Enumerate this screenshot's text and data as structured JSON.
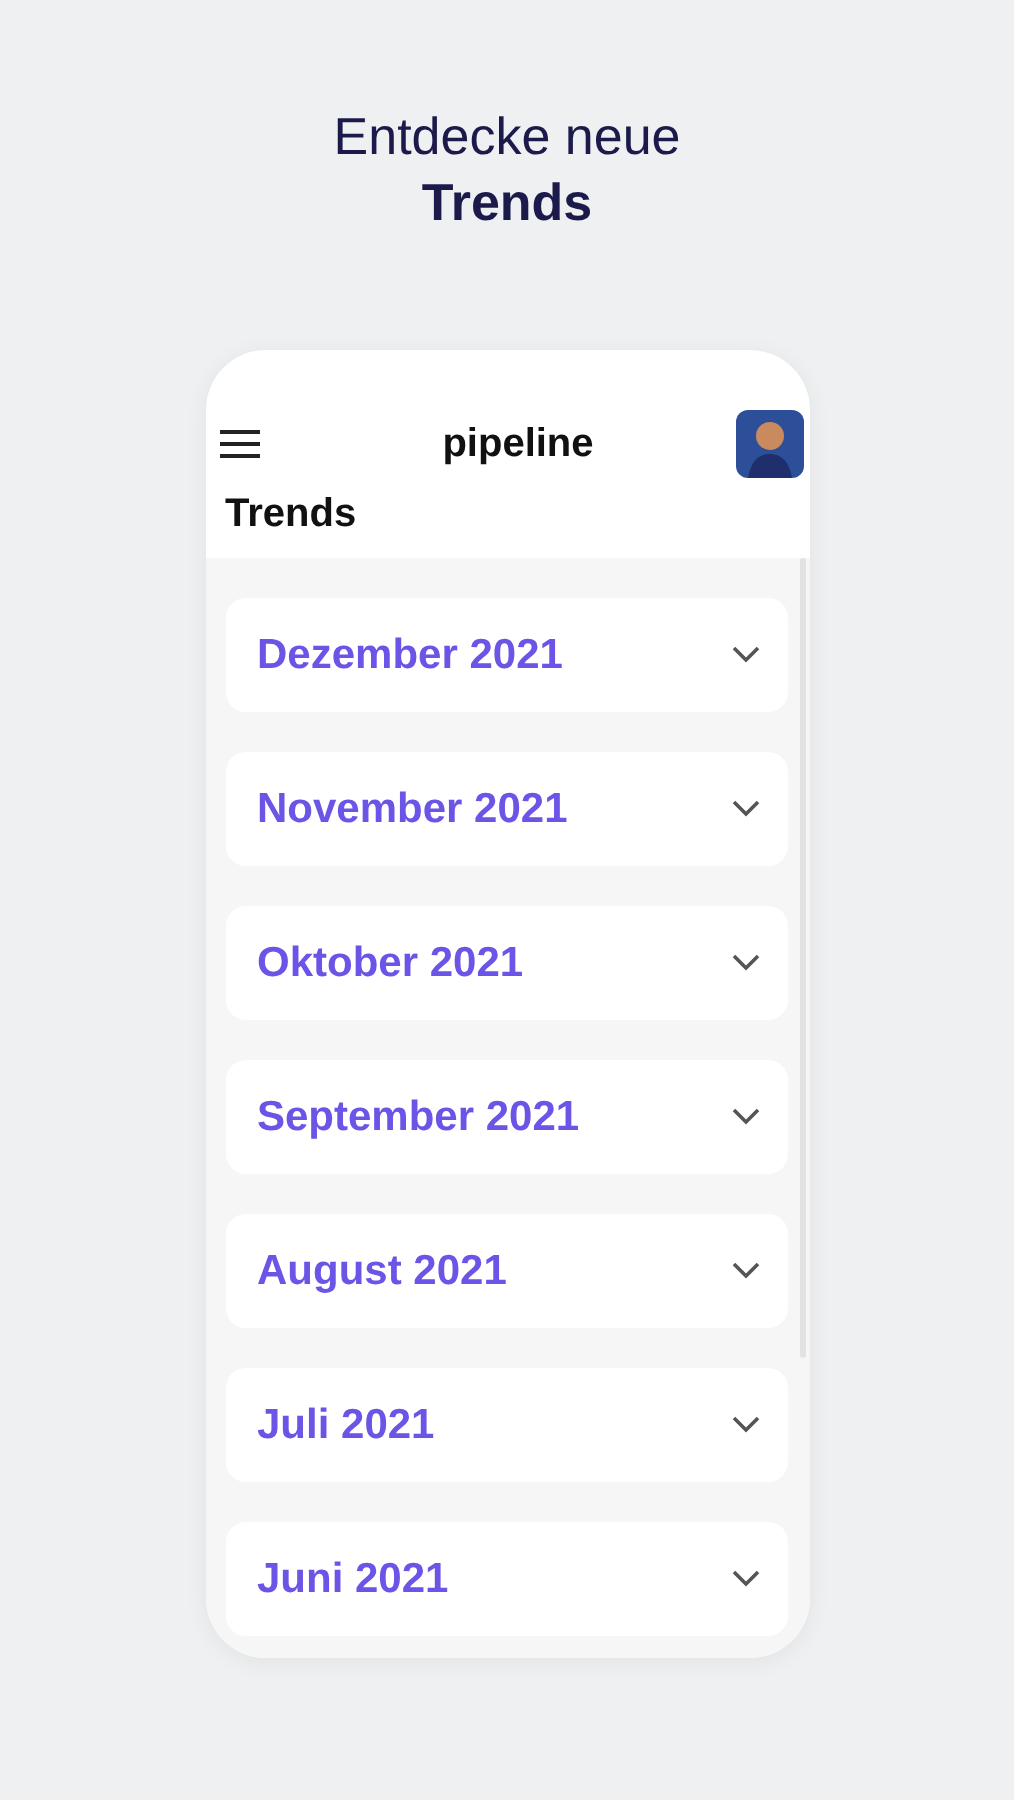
{
  "headline": {
    "line_1": "Entdecke neue",
    "line_2": "Trends"
  },
  "app_bar": {
    "title": "pipeline"
  },
  "page_title": "Trends",
  "months": [
    {
      "label": "Dezember 2021",
      "expanded": false
    },
    {
      "label": "November 2021",
      "expanded": false
    },
    {
      "label": "Oktober 2021",
      "expanded": false
    },
    {
      "label": "September 2021",
      "expanded": false
    },
    {
      "label": "August 2021",
      "expanded": false
    },
    {
      "label": "Juli 2021",
      "expanded": false
    },
    {
      "label": "Juni 2021",
      "expanded": false
    }
  ]
}
